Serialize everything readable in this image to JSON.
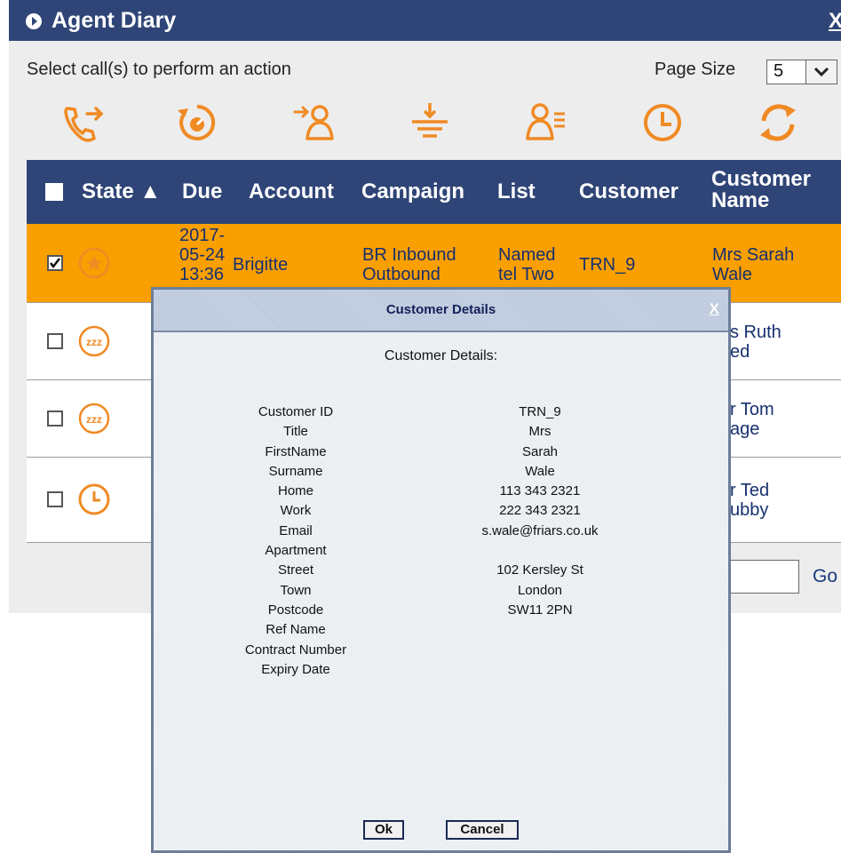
{
  "window": {
    "title": "Agent Diary",
    "close_label": "X"
  },
  "toolbar": {
    "instruction": "Select call(s) to perform an action",
    "page_size_label": "Page Size",
    "page_size_value": "5"
  },
  "accent_color": "#f08a24",
  "header_color": "#2f4577",
  "table": {
    "columns": {
      "state": "State ▲",
      "due": "Due",
      "account": "Account",
      "campaign": "Campaign",
      "list": "List",
      "customer": "Customer",
      "customer_name_line1": "Customer",
      "customer_name_line2": "Name"
    },
    "rows": [
      {
        "checked": true,
        "state_icon": "star-icon",
        "due_line1": "2017-",
        "due_line2": "05-24",
        "due_line3": "13:36",
        "account": "Brigitte",
        "campaign_line1": "BR Inbound",
        "campaign_line2": "Outbound",
        "list_line1": "Named",
        "list_line2": "tel Two",
        "customer": "TRN_9",
        "name_line1": "Mrs Sarah",
        "name_line2": "Wale"
      },
      {
        "checked": false,
        "state_icon": "snooze-icon",
        "name_line1": "s Ruth",
        "name_line2": "ed"
      },
      {
        "checked": false,
        "state_icon": "snooze-icon",
        "name_line1": "r Tom",
        "name_line2": "age"
      },
      {
        "checked": false,
        "state_icon": "clock-icon",
        "name_line1": "r Ted",
        "name_line2": "ubby"
      }
    ]
  },
  "pager": {
    "go_label": "Go"
  },
  "modal": {
    "title": "Customer Details",
    "close_label": "X",
    "subtitle": "Customer Details:",
    "fields": [
      {
        "label": "Customer ID",
        "value": "TRN_9"
      },
      {
        "label": "Title",
        "value": "Mrs"
      },
      {
        "label": "FirstName",
        "value": "Sarah"
      },
      {
        "label": "Surname",
        "value": "Wale"
      },
      {
        "label": "Home",
        "value": "113 343 2321"
      },
      {
        "label": "Work",
        "value": "222 343 2321"
      },
      {
        "label": "Email",
        "value": "s.wale@friars.co.uk"
      },
      {
        "label": "Apartment",
        "value": ""
      },
      {
        "label": "Street",
        "value": "102 Kersley St"
      },
      {
        "label": "Town",
        "value": "London"
      },
      {
        "label": "Postcode",
        "value": "SW11 2PN"
      },
      {
        "label": "Ref Name",
        "value": ""
      },
      {
        "label": "Contract Number",
        "value": ""
      },
      {
        "label": "Expiry Date",
        "value": ""
      }
    ],
    "ok_label": "Ok",
    "cancel_label": "Cancel"
  }
}
